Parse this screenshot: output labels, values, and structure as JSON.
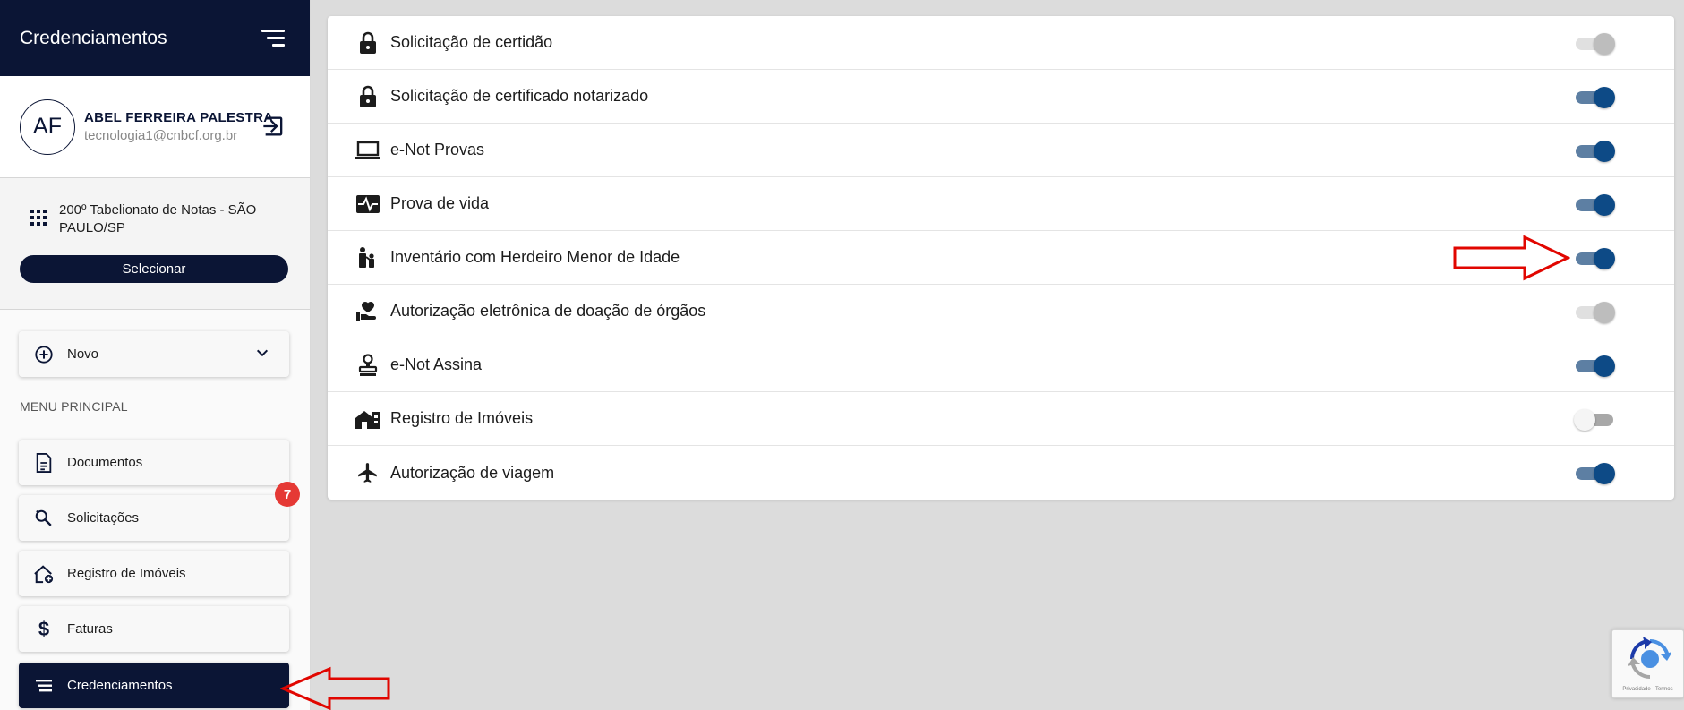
{
  "sidebar": {
    "title": "Credenciamentos",
    "user": {
      "initials": "AF",
      "name": "ABEL FERREIRA PALESTRA",
      "email": "tecnologia1@cnbcf.org.br"
    },
    "office": {
      "name": "200º Tabelionato de Notas - SÃO PAULO/SP",
      "select_label": "Selecionar"
    },
    "new_label": "Novo",
    "section_label": "MENU PRINCIPAL",
    "items": [
      {
        "label": "Documentos",
        "icon": "document-icon"
      },
      {
        "label": "Solicitações",
        "icon": "search-refresh-icon",
        "badge": "7"
      },
      {
        "label": "Registro de Imóveis",
        "icon": "house-add-icon"
      },
      {
        "label": "Faturas",
        "icon": "dollar-icon"
      },
      {
        "label": "Credenciamentos",
        "icon": "list-icon",
        "active": true
      }
    ]
  },
  "services": [
    {
      "label": "Solicitação de certidão",
      "icon": "lock-icon",
      "state": "disabled-on"
    },
    {
      "label": "Solicitação de certificado notarizado",
      "icon": "lock-icon",
      "state": "on"
    },
    {
      "label": "e-Not Provas",
      "icon": "laptop-icon",
      "state": "on"
    },
    {
      "label": "Prova de vida",
      "icon": "heartbeat-icon",
      "state": "on"
    },
    {
      "label": "Inventário com Herdeiro Menor de Idade",
      "icon": "family-icon",
      "state": "on"
    },
    {
      "label": "Autorização eletrônica de doação de órgãos",
      "icon": "hand-heart-icon",
      "state": "disabled-on"
    },
    {
      "label": "e-Not Assina",
      "icon": "stamp-icon",
      "state": "on"
    },
    {
      "label": "Registro de Imóveis",
      "icon": "buildings-icon",
      "state": "off"
    },
    {
      "label": "Autorização de viagem",
      "icon": "airplane-icon",
      "state": "on"
    }
  ],
  "recaptcha": {
    "text": "Privacidade - Termos"
  },
  "colors": {
    "navy": "#0b1535",
    "toggle_on": "#0d4a86",
    "badge": "#e53935",
    "annotation_arrow": "#e10600"
  }
}
